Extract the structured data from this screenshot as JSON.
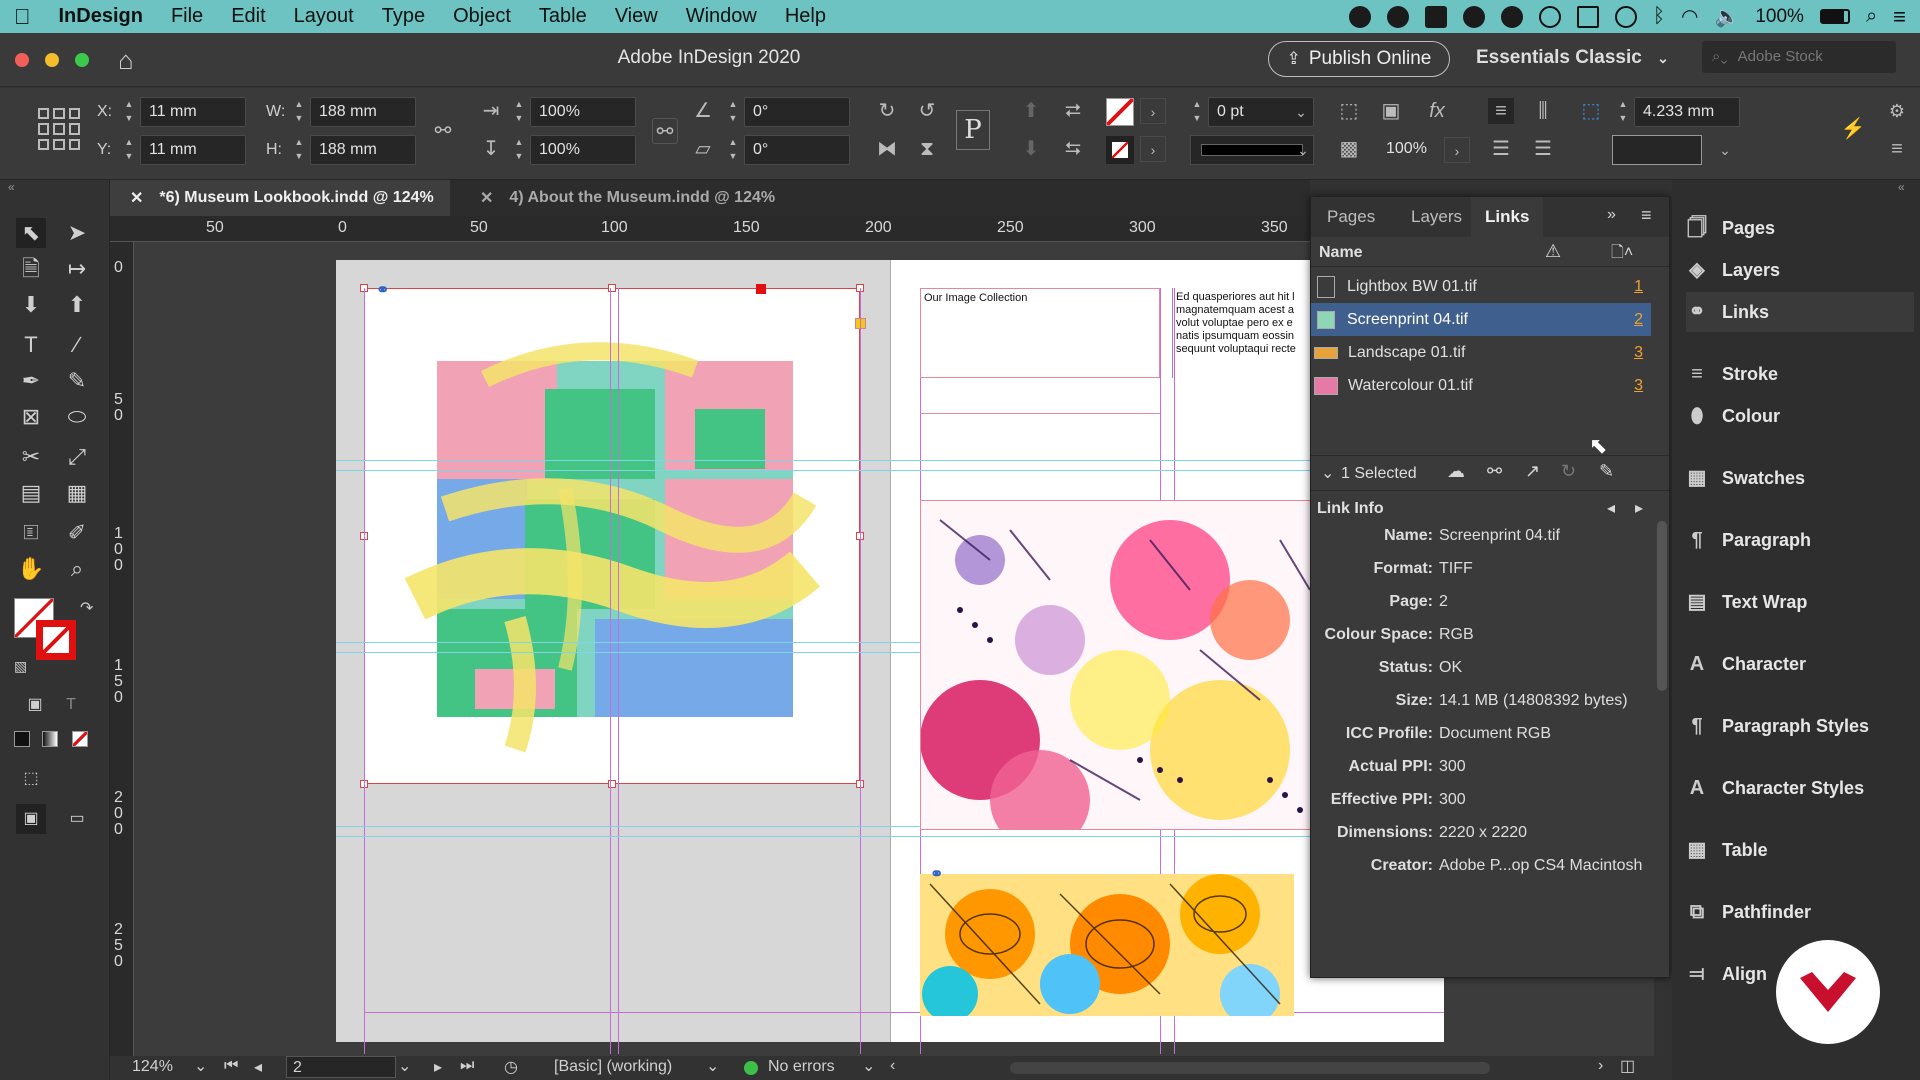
{
  "menubar": {
    "apple": "",
    "items": [
      "InDesign",
      "File",
      "Edit",
      "Layout",
      "Type",
      "Object",
      "Table",
      "View",
      "Window",
      "Help"
    ],
    "battery": "100%"
  },
  "titlebar": {
    "title": "Adobe InDesign 2020",
    "publish": "Publish Online",
    "workspace": "Essentials Classic",
    "stock_placeholder": "Adobe Stock"
  },
  "control": {
    "x_label": "X:",
    "x_value": "11 mm",
    "y_label": "Y:",
    "y_value": "11 mm",
    "w_label": "W:",
    "w_value": "188 mm",
    "h_label": "H:",
    "h_value": "188 mm",
    "scale_x": "100%",
    "scale_y": "100%",
    "rotate": "0°",
    "shear": "0°",
    "stroke_weight": "0 pt",
    "opacity": "100%",
    "spacing": "4.233 mm"
  },
  "tabs": [
    {
      "label": "*6) Museum Lookbook.indd @ 124%",
      "active": true
    },
    {
      "label": "4) About the Museum.indd @ 124%",
      "active": false
    }
  ],
  "ruler": {
    "h": [
      "50",
      "0",
      "50",
      "100",
      "150",
      "200",
      "250",
      "300",
      "350"
    ],
    "v": [
      "0",
      "5\n0",
      "1\n0\n0",
      "1\n5\n0",
      "2\n0\n0",
      "2\n5\n0"
    ]
  },
  "page": {
    "heading": "Our Image Collection",
    "body_lines": [
      "Ed quasperiores aut hit l",
      "magnatemquam acest a",
      "volut voluptae pero ex e",
      "natis ipsumquam eossin",
      "sequunt voluptaqui recte"
    ]
  },
  "links_panel": {
    "tabs": [
      "Pages",
      "Layers",
      "Links"
    ],
    "active_tab": "Links",
    "column_name": "Name",
    "links": [
      {
        "name": "Lightbox BW 01.tif",
        "page": "1",
        "selected": false,
        "thumb": "#3b3b3b"
      },
      {
        "name": "Screenprint 04.tif",
        "page": "2",
        "selected": true,
        "thumb": "#8fd6b5"
      },
      {
        "name": "Landscape 01.tif",
        "page": "3",
        "selected": false,
        "thumb": "#e6a33c"
      },
      {
        "name": "Watercolour 01.tif",
        "page": "3",
        "selected": false,
        "thumb": "#e57aa6"
      }
    ],
    "selected_count": "1 Selected",
    "info_title": "Link Info",
    "info": [
      {
        "k": "Name:",
        "v": "Screenprint 04.tif"
      },
      {
        "k": "Format:",
        "v": "TIFF"
      },
      {
        "k": "Page:",
        "v": "2"
      },
      {
        "k": "Colour Space:",
        "v": "RGB"
      },
      {
        "k": "Status:",
        "v": "OK"
      },
      {
        "k": "Size:",
        "v": "14.1 MB (14808392 bytes)"
      },
      {
        "k": "ICC Profile:",
        "v": "Document RGB"
      },
      {
        "k": "Actual PPI:",
        "v": "300"
      },
      {
        "k": "Effective PPI:",
        "v": "300"
      },
      {
        "k": "Dimensions:",
        "v": "2220 x 2220"
      },
      {
        "k": "Creator:",
        "v": "Adobe P...op CS4 Macintosh"
      }
    ]
  },
  "dock": [
    {
      "label": "Pages",
      "icon": "pages-icon"
    },
    {
      "label": "Layers",
      "icon": "layers-icon"
    },
    {
      "label": "Links",
      "icon": "links-icon",
      "active": true
    },
    {
      "label": "Stroke",
      "icon": "stroke-icon"
    },
    {
      "label": "Colour",
      "icon": "colour-icon"
    },
    {
      "label": "Swatches",
      "icon": "swatches-icon"
    },
    {
      "label": "Paragraph",
      "icon": "paragraph-icon"
    },
    {
      "label": "Text Wrap",
      "icon": "text-wrap-icon"
    },
    {
      "label": "Character",
      "icon": "character-icon"
    },
    {
      "label": "Paragraph Styles",
      "icon": "paragraph-styles-icon"
    },
    {
      "label": "Character Styles",
      "icon": "character-styles-icon"
    },
    {
      "label": "Table",
      "icon": "table-icon"
    },
    {
      "label": "Pathfinder",
      "icon": "pathfinder-icon"
    },
    {
      "label": "Align",
      "icon": "align-icon"
    }
  ],
  "status": {
    "zoom": "124%",
    "page": "2",
    "style": "[Basic] (working)",
    "preflight": "No errors"
  },
  "colors": {
    "menubar": "#6cc3c2",
    "selection": "#3f5f8f",
    "page_link_number": "#f0a030",
    "preflight_ok": "#3cc04a",
    "brand_badge": "#c8102e"
  }
}
